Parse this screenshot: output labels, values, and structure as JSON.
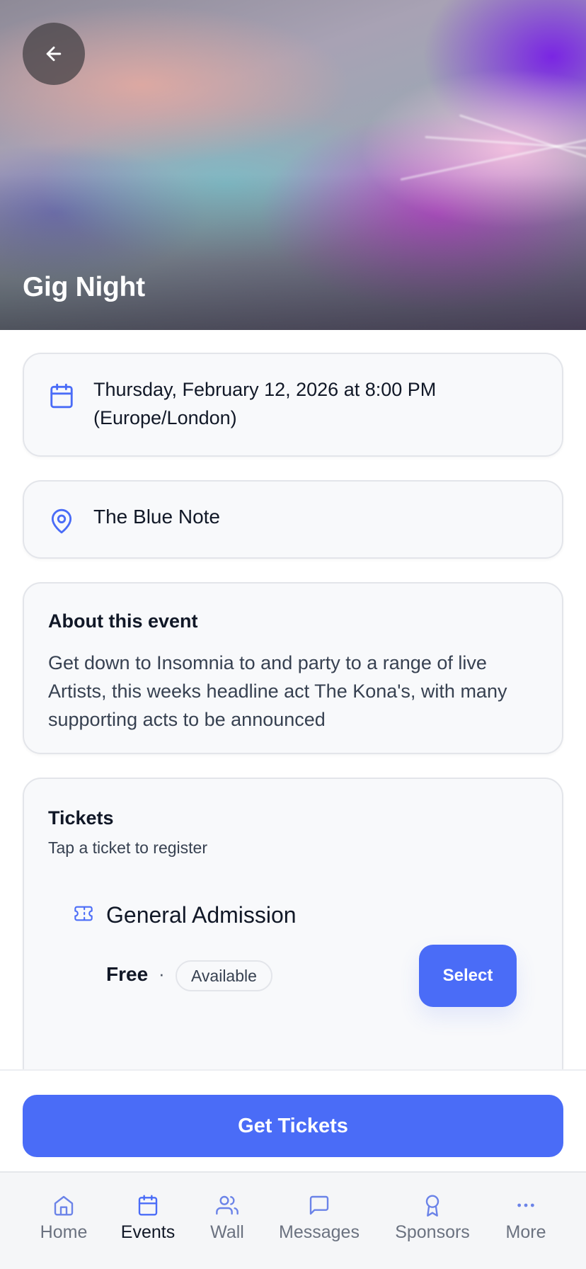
{
  "event": {
    "title": "Gig Night",
    "datetime": "Thursday, February 12, 2026 at 8:00 PM (Europe/London)",
    "venue": "The Blue Note"
  },
  "about": {
    "heading": "About this event",
    "description": "Get down to Insomnia to and party to a range of live Artists, this weeks headline act The Kona's, with many supporting acts to be announced"
  },
  "tickets": {
    "heading": "Tickets",
    "subheading": "Tap a ticket to register",
    "items": [
      {
        "name": "General Admission",
        "price": "Free",
        "separator": "·",
        "status": "Available",
        "action": "Select"
      }
    ]
  },
  "cta": {
    "label": "Get Tickets"
  },
  "nav": {
    "items": [
      {
        "label": "Home",
        "icon": "home-icon"
      },
      {
        "label": "Events",
        "icon": "calendar-icon",
        "active": true
      },
      {
        "label": "Wall",
        "icon": "users-icon"
      },
      {
        "label": "Messages",
        "icon": "message-icon"
      },
      {
        "label": "Sponsors",
        "icon": "award-icon"
      },
      {
        "label": "More",
        "icon": "more-icon"
      }
    ]
  },
  "colors": {
    "accent": "#4a6cf7",
    "card_bg": "#f8f9fb",
    "border": "#e3e5ea"
  }
}
